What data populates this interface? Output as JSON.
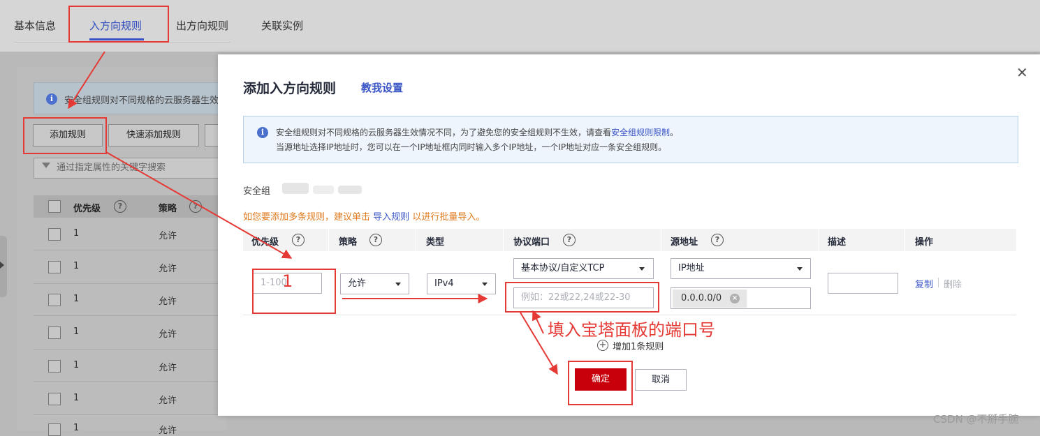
{
  "tabs": [
    {
      "label": "基本信息"
    },
    {
      "label": "入方向规则"
    },
    {
      "label": "出方向规则"
    },
    {
      "label": "关联实例"
    }
  ],
  "background": {
    "info_text": "安全组规则对不同规格的云服务器生效",
    "add_rule": "添加规则",
    "quick_add_rule": "快速添加规则",
    "search_placeholder": "通过指定属性的关键字搜索",
    "columns": [
      "优先级",
      "策略"
    ],
    "rows": [
      {
        "priority": "1",
        "policy": "允许"
      },
      {
        "priority": "1",
        "policy": "允许"
      },
      {
        "priority": "1",
        "policy": "允许"
      },
      {
        "priority": "1",
        "policy": "允许"
      },
      {
        "priority": "1",
        "policy": "允许"
      },
      {
        "priority": "1",
        "policy": "允许"
      },
      {
        "priority": "1",
        "policy": "允许"
      }
    ]
  },
  "modal": {
    "title": "添加入方向规则",
    "help_link": "教我设置",
    "info_line1": "安全组规则对不同规格的云服务器生效情况不同，为了避免您的安全组规则不生效，请查看",
    "info_link": "安全组规则限制",
    "info_line1_end": "。",
    "info_line2": "当源地址选择IP地址时，您可以在一个IP地址框内同时输入多个IP地址，一个IP地址对应一条安全组规则。",
    "security_group_label": "安全组",
    "bulk_tip_prefix": "如您要添加多条规则，建议单击",
    "bulk_tip_link": "导入规则",
    "bulk_tip_suffix": "以进行批量导入。",
    "columns": {
      "priority": "优先级",
      "policy": "策略",
      "type": "类型",
      "protocol_port": "协议端口",
      "source": "源地址",
      "description": "描述",
      "operation": "操作"
    },
    "row": {
      "priority_placeholder": "1-100",
      "policy": "允许",
      "type": "IPv4",
      "protocol": "基本协议/自定义TCP",
      "port_placeholder": "例如：22或22,24或22-30",
      "source_type": "IP地址",
      "source_ip": "0.0.0.0/0",
      "copy": "复制",
      "delete": "删除"
    },
    "add_row": "增加1条规则",
    "confirm": "确定",
    "cancel": "取消"
  },
  "annotations": {
    "number": "1",
    "port_note": "填入宝塔面板的端口号"
  },
  "watermark": "CSDN @不掰手腕"
}
